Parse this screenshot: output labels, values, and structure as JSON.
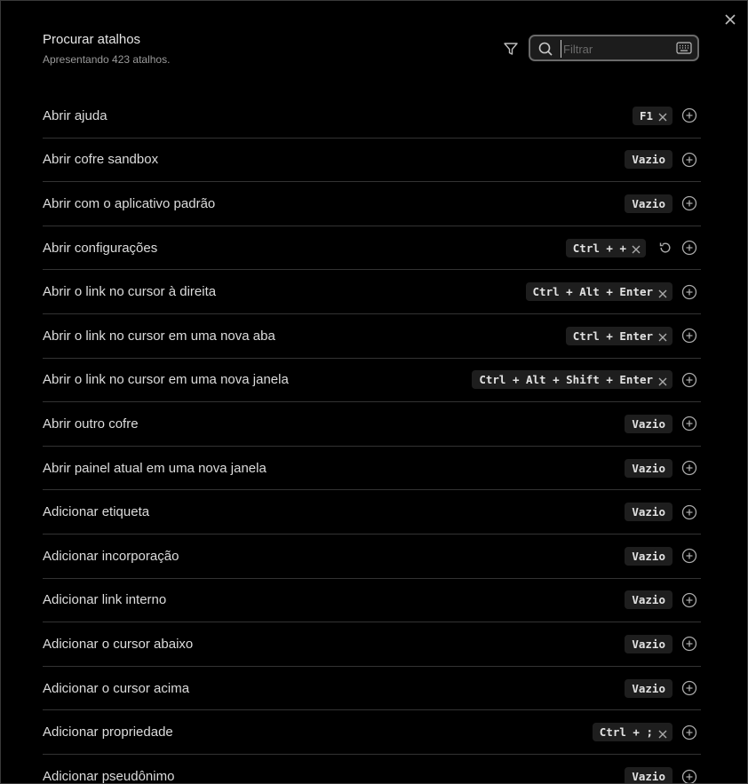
{
  "header": {
    "title": "Procurar atalhos",
    "subtitle": "Apresentando 423 atalhos."
  },
  "search": {
    "placeholder": "Filtrar",
    "value": ""
  },
  "empty_label": "Vazio",
  "rows": [
    {
      "label": "Abrir ajuda",
      "hotkey": "F1",
      "empty": false,
      "reset": false
    },
    {
      "label": "Abrir cofre sandbox",
      "hotkey": "Vazio",
      "empty": true,
      "reset": false
    },
    {
      "label": "Abrir com o aplicativo padrão",
      "hotkey": "Vazio",
      "empty": true,
      "reset": false
    },
    {
      "label": "Abrir configurações",
      "hotkey": "Ctrl + +",
      "empty": false,
      "reset": true
    },
    {
      "label": "Abrir o link no cursor à direita",
      "hotkey": "Ctrl + Alt + Enter",
      "empty": false,
      "reset": false
    },
    {
      "label": "Abrir o link no cursor em uma nova aba",
      "hotkey": "Ctrl + Enter",
      "empty": false,
      "reset": false
    },
    {
      "label": "Abrir o link no cursor em uma nova janela",
      "hotkey": "Ctrl + Alt + Shift + Enter",
      "empty": false,
      "reset": false
    },
    {
      "label": "Abrir outro cofre",
      "hotkey": "Vazio",
      "empty": true,
      "reset": false
    },
    {
      "label": "Abrir painel atual em uma nova janela",
      "hotkey": "Vazio",
      "empty": true,
      "reset": false
    },
    {
      "label": "Adicionar etiqueta",
      "hotkey": "Vazio",
      "empty": true,
      "reset": false
    },
    {
      "label": "Adicionar incorporação",
      "hotkey": "Vazio",
      "empty": true,
      "reset": false
    },
    {
      "label": "Adicionar link interno",
      "hotkey": "Vazio",
      "empty": true,
      "reset": false
    },
    {
      "label": "Adicionar o cursor abaixo",
      "hotkey": "Vazio",
      "empty": true,
      "reset": false
    },
    {
      "label": "Adicionar o cursor acima",
      "hotkey": "Vazio",
      "empty": true,
      "reset": false
    },
    {
      "label": "Adicionar propriedade",
      "hotkey": "Ctrl + ;",
      "empty": false,
      "reset": false
    },
    {
      "label": "Adicionar pseudônimo",
      "hotkey": "Vazio",
      "empty": true,
      "reset": false
    }
  ]
}
